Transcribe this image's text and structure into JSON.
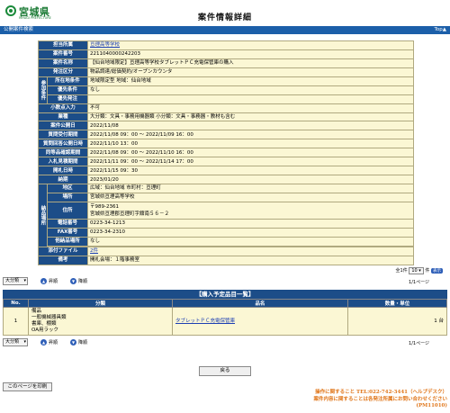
{
  "header": {
    "logo_text": "宮城県",
    "logo_sub": "MIYAGI PREFECTURE",
    "title": "案件情報詳細"
  },
  "section": {
    "title": "公開案件検索",
    "top_link": "Top"
  },
  "details": {
    "tanto": {
      "label": "担当所属",
      "value": "亘理高等学校"
    },
    "bango": {
      "label": "案件番号",
      "value": "2211040000242203"
    },
    "meisho": {
      "label": "案件名称",
      "value": "【仙台地域限定】亘理高等学校タブレットＰＣ充電保管庫の購入"
    },
    "kubun": {
      "label": "発注区分",
      "value": "物品調達/総価契約/オープンカウンタ"
    },
    "sanka_group": "参加条件",
    "shozai": {
      "label": "所在地条件",
      "value": "地域限定型 地域：仙台地域"
    },
    "yusen": {
      "label": "優先条件",
      "value": "なし"
    },
    "yusenhacchu": {
      "label": "優先発注",
      "value": ""
    },
    "shosu": {
      "label": "小数点入力",
      "value": "不可"
    },
    "gyoshu": {
      "label": "業種",
      "value": "大分類：文具・事務用機器類 小分類：文具・事務器・教材も含む"
    },
    "kokai": {
      "label": "案件公開日",
      "value": "2022/11/08"
    },
    "shitsumon": {
      "label": "質問受付期間",
      "value": "2022/11/08 09：00 〜 2022/11/09 16：00"
    },
    "kaito": {
      "label": "質問回答公開日時",
      "value": "2022/11/10 13：00"
    },
    "dotosho": {
      "label": "同等品確認期間",
      "value": "2022/11/08 09：00 〜 2022/11/10 16：00"
    },
    "nyusatsu": {
      "label": "入札見積期間",
      "value": "2022/11/11 09：00 〜 2022/11/14 17：00"
    },
    "kaisatsu": {
      "label": "開札日時",
      "value": "2022/11/15 09：30"
    },
    "noki": {
      "label": "納期",
      "value": "2023/01/20"
    },
    "nohin_group": "納品場所",
    "chiku": {
      "label": "地区",
      "value": "広域：仙台地域 市町村：亘理町"
    },
    "basho": {
      "label": "場所",
      "value": "宮城県亘理高等学校"
    },
    "jusho": {
      "label": "住所",
      "value_line1": "〒989-2361",
      "value_line2": "宮城県亘理郡亘理町字舘南５６－２"
    },
    "denwa": {
      "label": "電話番号",
      "value": "0223-34-1213"
    },
    "fax": {
      "label": "FAX番号",
      "value": "0223-34-2310"
    },
    "tanohin": {
      "label": "他納品場所",
      "value": "なし"
    },
    "tempu": {
      "label": "添付ファイル",
      "value": "2件"
    },
    "biko": {
      "label": "備考",
      "value": "開札会場：１階事務室"
    }
  },
  "pagination": {
    "sort_label": "大分類",
    "prev_label": "昇順",
    "next_label": "降順",
    "count_prefix": "全1件",
    "per_page": "10",
    "count_suffix": "件",
    "go_label": "表示",
    "page_indicator": "1/1ページ"
  },
  "list": {
    "title": "【購入予定品目一覧】",
    "headers": {
      "no": "No.",
      "bunrui": "分類",
      "hinmei": "品名",
      "suryo": "数量・単位"
    },
    "rows": [
      {
        "no": "1",
        "bunrui_line1": "備品",
        "bunrui_line2": "一般機械器具類",
        "bunrui_line3": "書庫、棚類",
        "bunrui_line4": "OA用ラック",
        "hinmei": "タブレットＰＣ充電保管庫",
        "suryo": "1 台"
      }
    ]
  },
  "buttons": {
    "back": "戻る",
    "print": "このページを印刷"
  },
  "footer": {
    "line1": "操作に関すること TEL:022-742-3441（ヘルプデスク）",
    "line2": "案件内容に関することは各発注所属にお問い合わせください",
    "line3": "(PM11010)"
  }
}
